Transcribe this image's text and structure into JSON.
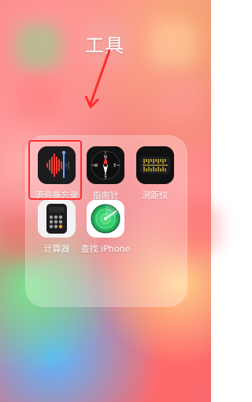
{
  "annotation": {
    "title": "工具"
  },
  "folder": {
    "apps": [
      {
        "id": "voice_memos",
        "label": "语音备忘录"
      },
      {
        "id": "compass",
        "label": "指南针"
      },
      {
        "id": "measure",
        "label": "测距仪"
      },
      {
        "id": "calculator",
        "label": "计算器"
      },
      {
        "id": "find_my_iphone",
        "label": "查找 iPhone"
      }
    ]
  },
  "colors": {
    "highlight": "#ff2d2d",
    "background": "#e46c73",
    "voice_icon_bg": "#1c1c1e",
    "voice_wave": "#ff3b30",
    "compass_bg": "#121212",
    "measure_bg": "#111111",
    "calculator_bg": "#f2f2f2",
    "findmy_bg": "#ffffff",
    "findmy_green": "#2ecc71"
  }
}
